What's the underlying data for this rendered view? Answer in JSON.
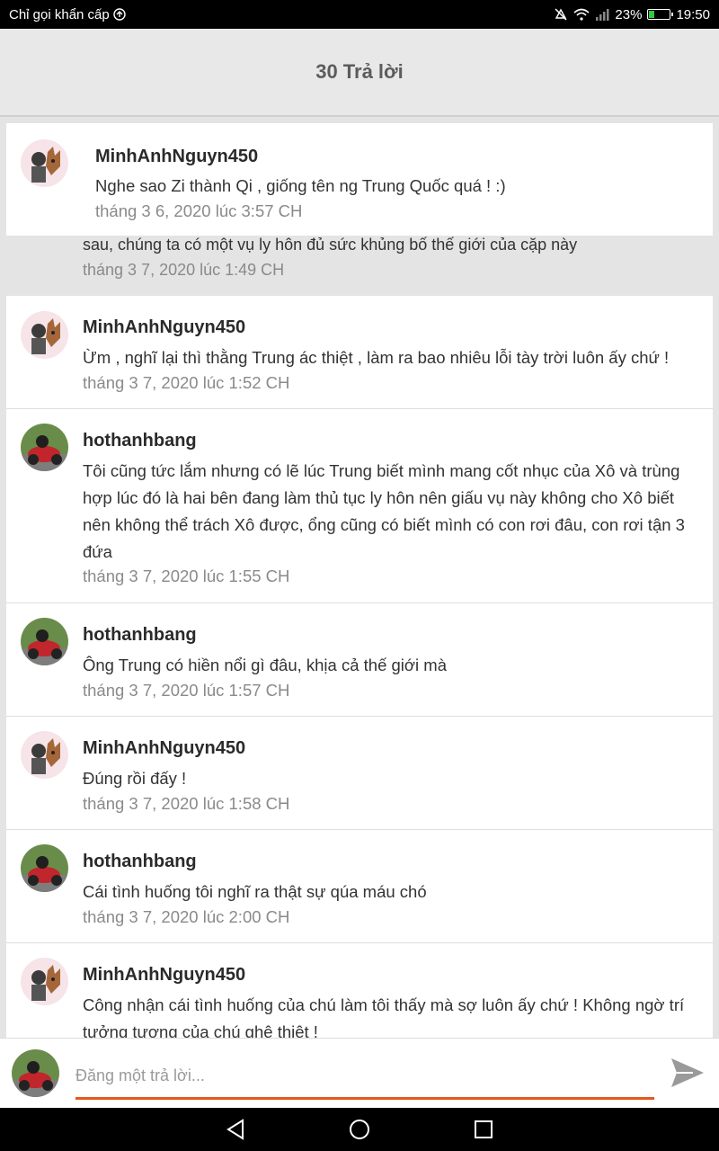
{
  "status_bar": {
    "carrier_text": "Chỉ gọi khẩn cấp",
    "battery": "23%",
    "battery_level": 0.23,
    "time": "19:50",
    "icons": [
      "mute-icon",
      "wifi-icon",
      "signal-icon",
      "battery-icon"
    ]
  },
  "header": {
    "title": "30 Trả lời"
  },
  "pinned_comment": {
    "username": "MinhAnhNguyn450",
    "text": "Nghe sao Zi thành Qi , giống tên ng Trung Quốc quá ! :)",
    "time": "tháng 3 6, 2020 lúc 3:57 CH"
  },
  "partial_comment": {
    "text": "sau, chúng ta có một vụ ly hôn đủ sức khủng bố thế giới của cặp này",
    "time": "tháng 3 7, 2020 lúc 1:49 CH"
  },
  "comments": [
    {
      "username": "MinhAnhNguyn450",
      "text": "Ừm , nghĩ lại thì thằng Trung ác thiệt , làm ra bao nhiêu lỗi tày trời luôn ấy chứ !",
      "time": "tháng 3 7, 2020 lúc 1:52 CH"
    },
    {
      "username": "hothanhbang",
      "text": "Tôi cũng tức lắm nhưng có lẽ lúc Trung biết mình mang cốt nhục của Xô và trùng hợp lúc đó là hai bên đang làm thủ tục ly hôn nên giấu vụ này không cho Xô biết nên không thể trách Xô được, ổng cũng có biết mình có con rơi đâu, con rơi tận 3 đứa",
      "time": "tháng 3 7, 2020 lúc 1:55 CH"
    },
    {
      "username": "hothanhbang",
      "text": "Ông Trung có hiền nổi gì đâu, khịa cả thế giới mà",
      "time": "tháng 3 7, 2020 lúc 1:57 CH"
    },
    {
      "username": "MinhAnhNguyn450",
      "text": "Đúng rồi đấy !",
      "time": "tháng 3 7, 2020 lúc 1:58 CH"
    },
    {
      "username": "hothanhbang",
      "text": "Cái tình huống tôi nghĩ ra thật sự qúa máu chó",
      "time": "tháng 3 7, 2020 lúc 2:00 CH"
    },
    {
      "username": "MinhAnhNguyn450",
      "text": "Công nhận cái tình huống của chú làm tôi thấy mà sợ luôn ấy chứ ! Không ngờ trí tưởng tượng của chú ghê thiệt !",
      "time": ""
    }
  ],
  "composer": {
    "placeholder": "Đăng một trả lời..."
  },
  "colors": {
    "accent": "#e2581b",
    "header_bg": "#e8e8e8",
    "page_bg": "#e4e4e4"
  }
}
